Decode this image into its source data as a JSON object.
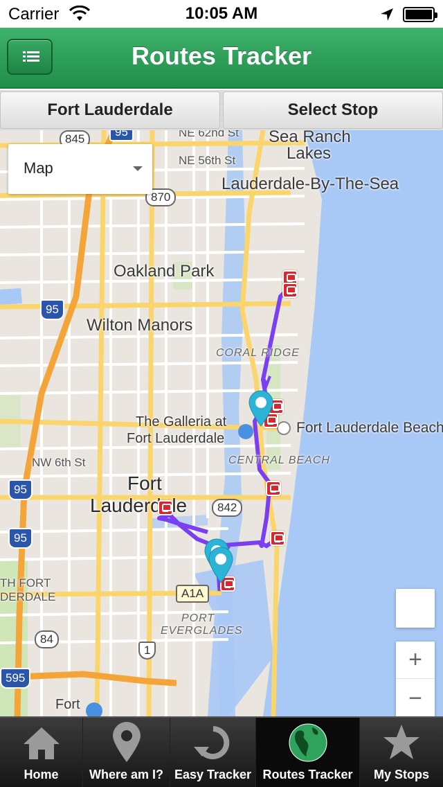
{
  "status_bar": {
    "carrier": "Carrier",
    "time": "10:05 AM"
  },
  "header": {
    "title": "Routes Tracker",
    "menu_icon": "list-icon"
  },
  "selectors": {
    "city": "Fort Lauderdale",
    "stop": "Select Stop"
  },
  "map": {
    "map_type": "Map",
    "labels": {
      "sea_ranch_lakes_1": "Sea Ranch",
      "sea_ranch_lakes_2": "Lakes",
      "ne_62nd": "NE 62nd St",
      "ne_56th": "NE 56th St",
      "lauderdale_by_the_sea": "Lauderdale-By-The-Sea",
      "oakland_park": "Oakland Park",
      "wilton_manors": "Wilton Manors",
      "coral_ridge": "CORAL RIDGE",
      "galleria_1": "The Galleria at",
      "galleria_2": "Fort Lauderdale",
      "fort_lauderdale_beach": "Fort Lauderdale Beach",
      "nw_6th": "NW 6th St",
      "central_beach": "CENTRAL BEACH",
      "fort_1": "Fort",
      "fort_2": "Lauderdale",
      "north_fort_1": "TH FORT",
      "north_fort_2": "DERDALE",
      "port_everglades_1": "PORT",
      "port_everglades_2": "EVERGLADES",
      "fort_airport": "Fort"
    },
    "road_shields": {
      "r845": "845",
      "r95_top": "95",
      "r870": "870",
      "i95_a": "95",
      "i95_b": "95",
      "i95_c": "95",
      "r842": "842",
      "a1a": "A1A",
      "r84": "84",
      "us1": "1",
      "i595": "595"
    },
    "zoom_in": "+",
    "zoom_out": "−",
    "route_color": "#7a3ff0",
    "pin_color": "#2bb3d8",
    "stop_color": "#d7282f"
  },
  "tabs": [
    {
      "label": "Home",
      "icon": "home-icon"
    },
    {
      "label": "Where am I?",
      "icon": "location-pin-icon"
    },
    {
      "label": "Easy Tracker",
      "icon": "refresh-icon"
    },
    {
      "label": "Routes Tracker",
      "icon": "globe-icon"
    },
    {
      "label": "My Stops",
      "icon": "star-icon"
    }
  ]
}
